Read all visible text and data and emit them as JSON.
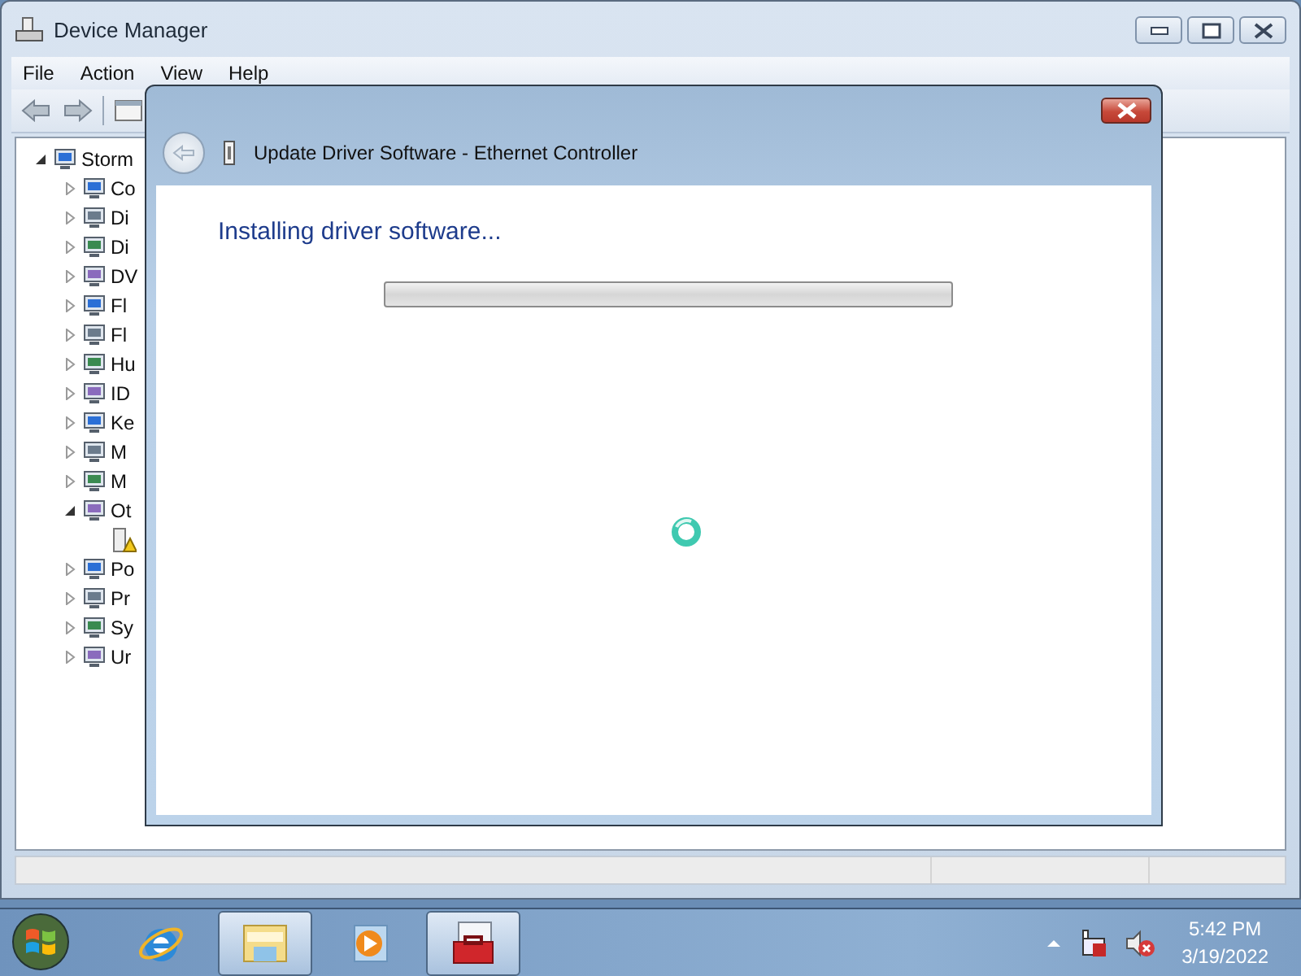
{
  "device_manager": {
    "title": "Device Manager",
    "menu": [
      "File",
      "Action",
      "View",
      "Help"
    ],
    "tree": [
      {
        "label": "Storm",
        "expanded": true,
        "children": [
          {
            "label": "Co",
            "expanded": false
          },
          {
            "label": "Di",
            "expanded": false
          },
          {
            "label": "Di",
            "expanded": false
          },
          {
            "label": "DV",
            "expanded": false
          },
          {
            "label": "Fl",
            "expanded": false
          },
          {
            "label": "Fl",
            "expanded": false
          },
          {
            "label": "Hu",
            "expanded": false
          },
          {
            "label": "ID",
            "expanded": false
          },
          {
            "label": "Ke",
            "expanded": false
          },
          {
            "label": "M",
            "expanded": false
          },
          {
            "label": "M",
            "expanded": false
          },
          {
            "label": "Ot",
            "expanded": true,
            "children": [
              {
                "warning": true
              }
            ]
          },
          {
            "label": "Po",
            "expanded": false
          },
          {
            "label": "Pr",
            "expanded": false
          },
          {
            "label": "Sy",
            "expanded": false
          },
          {
            "label": "Ur",
            "expanded": false
          }
        ]
      }
    ]
  },
  "dialog": {
    "title": "Update Driver Software - Ethernet Controller",
    "heading": "Installing driver software...",
    "progress": {
      "level": 0
    }
  },
  "taskbar": {
    "apps": [
      {
        "kind": "browser",
        "open": false
      },
      {
        "kind": "folder",
        "open": true
      },
      {
        "kind": "media",
        "open": false
      },
      {
        "kind": "toolbox",
        "open": true
      }
    ],
    "time": "5:42 PM",
    "date": "3/19/2022"
  }
}
